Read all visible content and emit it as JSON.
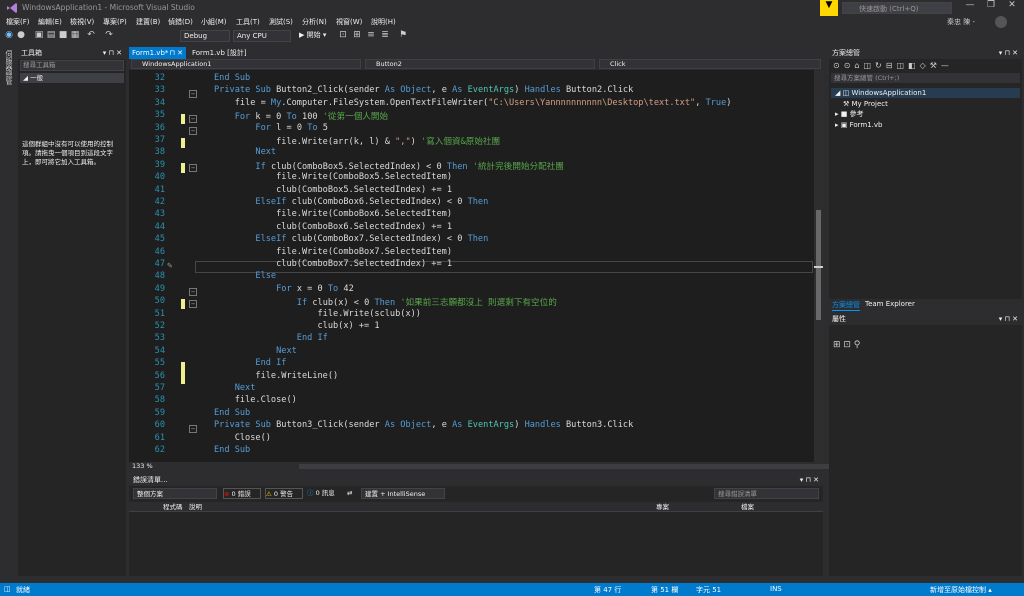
{
  "title": "WindowsApplication1 - Microsoft Visual Studio",
  "quick_launch": "快速啟動 (Ctrl+Q)",
  "user": "秦忠 陳 -",
  "menu": [
    "檔案(F)",
    "編輯(E)",
    "檢視(V)",
    "專案(P)",
    "建置(B)",
    "偵錯(D)",
    "小組(M)",
    "工具(T)",
    "測試(S)",
    "分析(N)",
    "視窗(W)",
    "說明(H)"
  ],
  "toolbar": {
    "config": "Debug",
    "platform": "Any CPU",
    "start": "▶ 開始 ▾"
  },
  "side_tab": "伺服器總管",
  "toolbox": {
    "title": "工具箱",
    "search_placeholder": "搜尋工具箱",
    "group": "◢ 一般",
    "message": "這個群組中沒有可以使用的控制項。請拖曳一個項目到這段文字上，即可將它加入工具箱。"
  },
  "doc_tabs": [
    "Form1.vb*",
    "Form1.vb [設計]"
  ],
  "nav": {
    "project": "WindowsApplication1",
    "object": "Button2",
    "event": "Click"
  },
  "zoom": "133 %",
  "code_lines": [
    {
      "num": "32",
      "html": "<span class='kw'>End Sub</span>"
    },
    {
      "num": "33",
      "html": "<span class='kw'>Private Sub</span> <span class='tx'>Button2_Click(sender</span> <span class='kw'>As Object</span><span class='tx'>, e</span> <span class='kw'>As</span> <span class='ty'>EventArgs</span><span class='tx'>)</span> <span class='kw'>Handles</span> <span class='tx'>Button2.Click</span>"
    },
    {
      "num": "34",
      "html": "    <span class='tx'>file = </span><span class='kw'>My</span><span class='tx'>.Computer.FileSystem.OpenTextFileWriter(</span><span class='st'>\"C:\\Users\\Yannnnnnnnnn\\Desktop\\text.txt\"</span><span class='tx'>, </span><span class='kw'>True</span><span class='tx'>)</span>"
    },
    {
      "num": "35",
      "html": "    <span class='kw'>For</span> <span class='tx'>k = 0</span> <span class='kw'>To</span> <span class='tx'>100</span> <span class='cm'>'從第一個人開始</span>"
    },
    {
      "num": "36",
      "html": "        <span class='kw'>For</span> <span class='tx'>l = 0</span> <span class='kw'>To</span> <span class='tx'>5</span>"
    },
    {
      "num": "37",
      "html": "            <span class='tx'>file.Write(arr(k, l) &amp; </span><span class='st'>\",\"</span><span class='tx'>)</span> <span class='cm'>'寫入個資&amp;原始社團</span>"
    },
    {
      "num": "38",
      "html": "        <span class='kw'>Next</span>"
    },
    {
      "num": "39",
      "html": "        <span class='kw'>If</span> <span class='tx'>club(ComboBox5.SelectedIndex) &lt; 0</span> <span class='kw'>Then</span> <span class='cm'>'統計完後開始分配社團</span>"
    },
    {
      "num": "40",
      "html": "            <span class='tx'>file.Write(ComboBox5.SelectedItem)</span>"
    },
    {
      "num": "41",
      "html": "            <span class='tx'>club(ComboBox5.SelectedIndex) += 1</span>"
    },
    {
      "num": "42",
      "html": "        <span class='kw'>ElseIf</span> <span class='tx'>club(ComboBox6.SelectedIndex) &lt; 0</span> <span class='kw'>Then</span>"
    },
    {
      "num": "43",
      "html": "            <span class='tx'>file.Write(ComboBox6.SelectedItem)</span>"
    },
    {
      "num": "44",
      "html": "            <span class='tx'>club(ComboBox6.SelectedIndex) += 1</span>"
    },
    {
      "num": "45",
      "html": "        <span class='kw'>ElseIf</span> <span class='tx'>club(ComboBox7.SelectedIndex) &lt; 0</span> <span class='kw'>Then</span>"
    },
    {
      "num": "46",
      "html": "            <span class='tx'>file.Write(ComboBox7.SelectedItem)</span>"
    },
    {
      "num": "47",
      "html": "            <span class='tx'>club(ComboBox7.SelectedIndex) += 1</span>"
    },
    {
      "num": "48",
      "html": "        <span class='kw'>Else</span>"
    },
    {
      "num": "49",
      "html": "            <span class='kw'>For</span> <span class='tx'>x = 0</span> <span class='kw'>To</span> <span class='tx'>42</span>"
    },
    {
      "num": "50",
      "html": "                <span class='kw'>If</span> <span class='tx'>club(x) &lt; 0</span> <span class='kw'>Then</span> <span class='cm'>'如果前三志願都沒上 則選剩下有空位的</span>"
    },
    {
      "num": "51",
      "html": "                    <span class='tx'>file.Write(sclub(x))</span>"
    },
    {
      "num": "52",
      "html": "                    <span class='tx'>club(x) += 1</span>"
    },
    {
      "num": "53",
      "html": "                <span class='kw'>End If</span>"
    },
    {
      "num": "54",
      "html": "            <span class='kw'>Next</span>"
    },
    {
      "num": "55",
      "html": "        <span class='kw'>End If</span>"
    },
    {
      "num": "56",
      "html": "        <span class='tx'>file.WriteLine()</span>"
    },
    {
      "num": "57",
      "html": "    <span class='kw'>Next</span>"
    },
    {
      "num": "58",
      "html": "    <span class='tx'>file.Close()</span>"
    },
    {
      "num": "59",
      "html": "<span class='kw'>End Sub</span>"
    },
    {
      "num": "60",
      "html": "<span class='kw'>Private Sub</span> <span class='tx'>Button3_Click(sender</span> <span class='kw'>As Object</span><span class='tx'>, e</span> <span class='kw'>As</span> <span class='ty'>EventArgs</span><span class='tx'>)</span> <span class='kw'>Handles</span> <span class='tx'>Button3.Click</span>"
    },
    {
      "num": "61",
      "html": "    <span class='tx'>Close()</span>"
    },
    {
      "num": "62",
      "html": "<span class='kw'>End Sub</span>"
    }
  ],
  "error_list": {
    "title": "錯誤清單...",
    "scope": "整個方案",
    "errors": "0 錯誤",
    "warnings": "0 警告",
    "messages": "0 訊息",
    "filter": "建置 + IntelliSense",
    "search_placeholder": "搜尋錯誤清單",
    "columns": [
      "程式碼",
      "說明",
      "專案",
      "檔案"
    ]
  },
  "solution_explorer": {
    "title": "方案總管",
    "search_placeholder": "搜尋方案總管 (Ctrl+;)",
    "solution": "WindowsApplication1",
    "items": [
      "My Project",
      "參考",
      "Form1.vb"
    ]
  },
  "right_tabs": [
    "方案總管",
    "Team Explorer"
  ],
  "properties_title": "屬性",
  "status": {
    "left": "就緒",
    "line": "第 47 行",
    "col": "第 51 欄",
    "char": "字元 51",
    "ins": "INS",
    "publish": "新增至原始檔控制 ▴"
  },
  "colors": {
    "accent": "#007acc",
    "background": "#1e1e1e",
    "keyword": "#569cd6",
    "comment": "#57a64a",
    "string": "#d69d85",
    "change_marker": "#efef91"
  }
}
